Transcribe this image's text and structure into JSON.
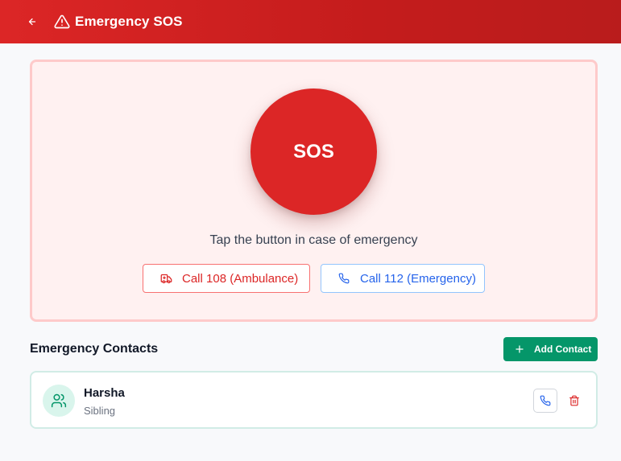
{
  "header": {
    "title": "Emergency SOS",
    "back_icon": "arrow-left-icon",
    "warning_icon": "alert-triangle-icon",
    "background": "#dc2626"
  },
  "sos_panel": {
    "button_label": "SOS",
    "hint": "Tap the button in case of emergency",
    "call_ambulance_label": "Call 108 (Ambulance)",
    "call_ambulance_icon": "ambulance-icon",
    "call_emergency_label": "Call 112 (Emergency)",
    "call_emergency_icon": "phone-icon",
    "accent_red": "#dc2626",
    "accent_blue": "#2563eb"
  },
  "contacts": {
    "title": "Emergency Contacts",
    "add_label": "Add Contact",
    "add_icon": "plus-icon",
    "accent_green": "#059669",
    "items": [
      {
        "name": "Harsha",
        "relation": "Sibling",
        "avatar_icon": "users-icon",
        "call_icon": "phone-icon",
        "delete_icon": "trash-icon"
      }
    ]
  }
}
